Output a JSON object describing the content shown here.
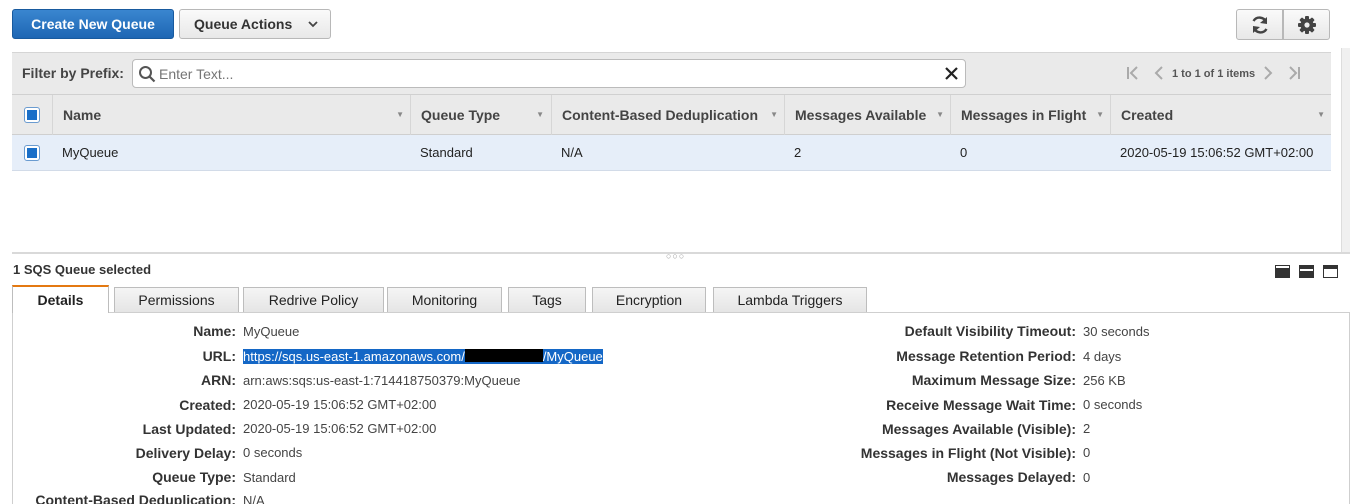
{
  "toolbar": {
    "create_label": "Create New Queue",
    "actions_label": "Queue Actions",
    "refresh_icon": "refresh-icon",
    "settings_icon": "gear-icon"
  },
  "filter": {
    "label": "Filter by Prefix:",
    "placeholder": "Enter Text...",
    "pager_text": "1 to 1 of 1 items"
  },
  "table": {
    "columns": [
      "Name",
      "Queue Type",
      "Content-Based Deduplication",
      "Messages Available",
      "Messages in Flight",
      "Created"
    ],
    "rows": [
      {
        "name": "MyQueue",
        "queue_type": "Standard",
        "dedup": "N/A",
        "available": "2",
        "in_flight": "0",
        "created": "2020-05-19 15:06:52 GMT+02:00"
      }
    ]
  },
  "details": {
    "selected_count": "1 SQS Queue selected",
    "tabs": [
      "Details",
      "Permissions",
      "Redrive Policy",
      "Monitoring",
      "Tags",
      "Encryption",
      "Lambda Triggers"
    ],
    "left": [
      {
        "label": "Name:",
        "value": "MyQueue"
      },
      {
        "label": "URL:",
        "value_prefix": "https://sqs.us-east-1.amazonaws.com/",
        "value_suffix": "/MyQueue"
      },
      {
        "label": "ARN:",
        "value": "arn:aws:sqs:us-east-1:714418750379:MyQueue"
      },
      {
        "label": "Created:",
        "value": "2020-05-19 15:06:52 GMT+02:00"
      },
      {
        "label": "Last Updated:",
        "value": "2020-05-19 15:06:52 GMT+02:00"
      },
      {
        "label": "Delivery Delay:",
        "value": "0 seconds"
      },
      {
        "label": "Queue Type:",
        "value": "Standard"
      },
      {
        "label": "Content-Based Deduplication:",
        "value": "N/A"
      }
    ],
    "right": [
      {
        "label": "Default Visibility Timeout:",
        "value": "30 seconds"
      },
      {
        "label": "Message Retention Period:",
        "value": "4 days"
      },
      {
        "label": "Maximum Message Size:",
        "value": "256 KB"
      },
      {
        "label": "Receive Message Wait Time:",
        "value": "0 seconds"
      },
      {
        "label": "Messages Available (Visible):",
        "value": "2"
      },
      {
        "label": "Messages in Flight (Not Visible):",
        "value": "0"
      },
      {
        "label": "Messages Delayed:",
        "value": "0"
      }
    ]
  },
  "colors": {
    "primary": "#1e66b4",
    "accent_tab": "#e47911",
    "selected_row": "#e6eef9"
  }
}
